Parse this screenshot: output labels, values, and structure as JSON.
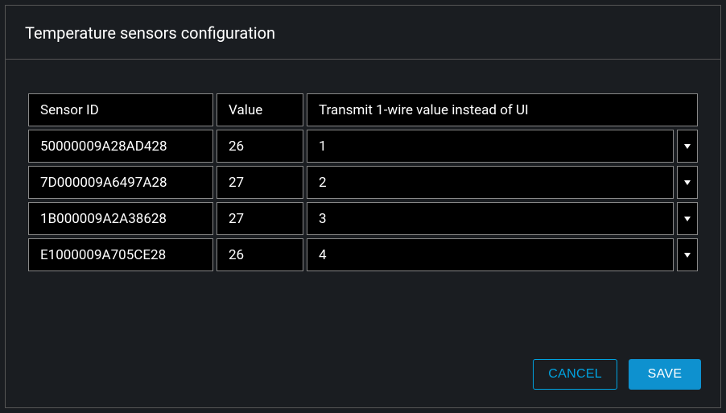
{
  "dialog": {
    "title": "Temperature sensors configuration"
  },
  "table": {
    "headers": {
      "sensor_id": "Sensor ID",
      "value": "Value",
      "transmit": "Transmit 1-wire value instead of UI"
    },
    "rows": [
      {
        "sensor_id": "50000009A28AD428",
        "value": "26",
        "transmit": "1"
      },
      {
        "sensor_id": "7D000009A6497A28",
        "value": "27",
        "transmit": "2"
      },
      {
        "sensor_id": "1B000009A2A38628",
        "value": "27",
        "transmit": "3"
      },
      {
        "sensor_id": "E1000009A705CE28",
        "value": "26",
        "transmit": "4"
      }
    ]
  },
  "buttons": {
    "cancel": "CANCEL",
    "save": "SAVE"
  }
}
